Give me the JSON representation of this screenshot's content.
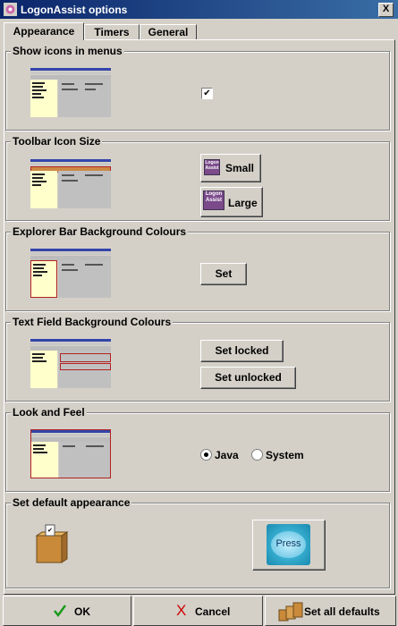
{
  "window": {
    "title": "LogonAssist options",
    "close_label": "X"
  },
  "tabs": [
    {
      "label": "Appearance",
      "active": true
    },
    {
      "label": "Timers",
      "active": false
    },
    {
      "label": "General",
      "active": false
    }
  ],
  "groups": {
    "icons_in_menus": {
      "title": "Show icons in menus",
      "checked": true
    },
    "toolbar_icon_size": {
      "title": "Toolbar Icon Size",
      "small_label": "Small",
      "large_label": "Large",
      "icon_text": "Logon Assist"
    },
    "explorer_bar": {
      "title": "Explorer Bar Background Colours",
      "set_label": "Set"
    },
    "text_field": {
      "title": "Text Field Background Colours",
      "locked_label": "Set locked",
      "unlocked_label": "Set unlocked"
    },
    "look_and_feel": {
      "title": "Look and Feel",
      "options": [
        "Java",
        "System"
      ],
      "selected": "Java"
    },
    "default_appearance": {
      "title": "Set default appearance",
      "press_label": "Press"
    }
  },
  "footer": {
    "ok_label": "OK",
    "cancel_label": "Cancel",
    "defaults_label": "Set all defaults"
  },
  "colors": {
    "title_bar": "#0a246a",
    "ok_check": "#1a9a1a",
    "cancel_x": "#cc0000",
    "highlight": "#b22222"
  }
}
